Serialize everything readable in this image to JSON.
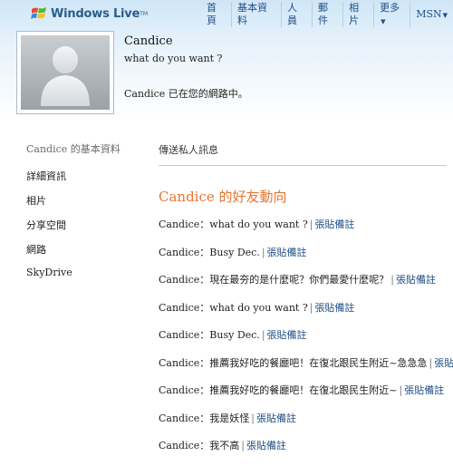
{
  "header": {
    "logo_text": "Windows Live",
    "logo_tm": "TM",
    "nav": [
      {
        "label": "首頁"
      },
      {
        "label": "基本資料"
      },
      {
        "label": "人員"
      },
      {
        "label": "郵件"
      },
      {
        "label": "相片"
      },
      {
        "label": "更多"
      },
      {
        "label": "MSN"
      }
    ]
  },
  "profile": {
    "name": "Candice",
    "status": "what do you want ?",
    "network_msg": "Candice 已在您的網路中。"
  },
  "sidebar": {
    "title": "Candice 的基本資料",
    "items": [
      {
        "label": "詳細資訊"
      },
      {
        "label": "相片"
      },
      {
        "label": "分享空間"
      },
      {
        "label": "網路"
      },
      {
        "label": "SkyDrive"
      }
    ]
  },
  "main": {
    "send_message": "傳送私人訊息",
    "feed_title": "Candice 的好友動向",
    "note_link_label": "張貼備註",
    "feed": [
      {
        "text": "Candice：what do you want ?",
        "link": "張貼備註"
      },
      {
        "text": "Candice：Busy Dec.",
        "link": "張貼備註"
      },
      {
        "text": "Candice：現在最夯的是什麼呢？你們最愛什麼呢？",
        "link": "張貼備註"
      },
      {
        "text": "Candice：what do you want ?",
        "link": "張貼備註"
      },
      {
        "text": "Candice：Busy Dec.",
        "link": "張貼備註"
      },
      {
        "text": "Candice：推薦我好吃的餐廳吧！在復北跟民生附近~急急急",
        "link": "張貼備註"
      },
      {
        "text": "Candice：推薦我好吃的餐廳吧！在復北跟民生附近~",
        "link": "張貼備註"
      },
      {
        "text": "Candice：我是妖怪",
        "link": "張貼備註"
      },
      {
        "text": "Candice：我不高",
        "link": "張貼備註"
      }
    ]
  },
  "colors": {
    "accent_orange": "#e8752f",
    "link_blue": "#1f4f86",
    "header_blue": "#cfe6f7"
  },
  "icons": {
    "logo": "windows-flag-icon",
    "avatar": "default-user-silhouette-icon",
    "more_caret": "caret-down-icon"
  }
}
